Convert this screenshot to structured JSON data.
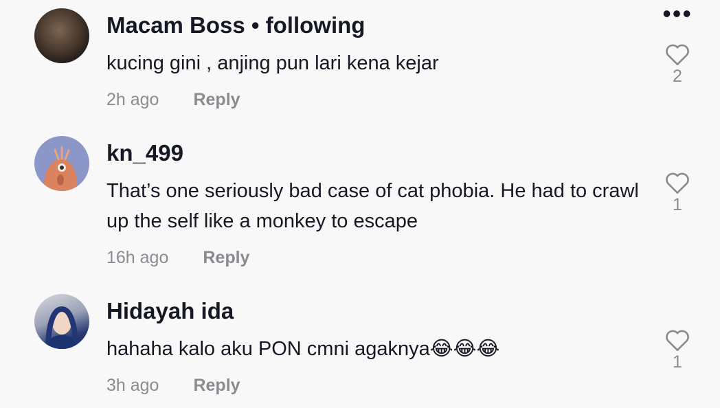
{
  "more_label": "•••",
  "comments": [
    {
      "username": "Macam Boss • following",
      "text": "kucing gini , anjing pun lari kena kejar",
      "time": "2h ago",
      "reply_label": "Reply",
      "likes": "2"
    },
    {
      "username": "kn_499",
      "text": "That’s one seriously bad case of cat phobia. He had to crawl up the self like a monkey to escape",
      "time": "16h ago",
      "reply_label": "Reply",
      "likes": "1"
    },
    {
      "username": "Hidayah ida",
      "text": "hahaha kalo aku PON cmni agaknya😂😂😂",
      "time": "3h ago",
      "reply_label": "Reply",
      "likes": "1"
    }
  ]
}
